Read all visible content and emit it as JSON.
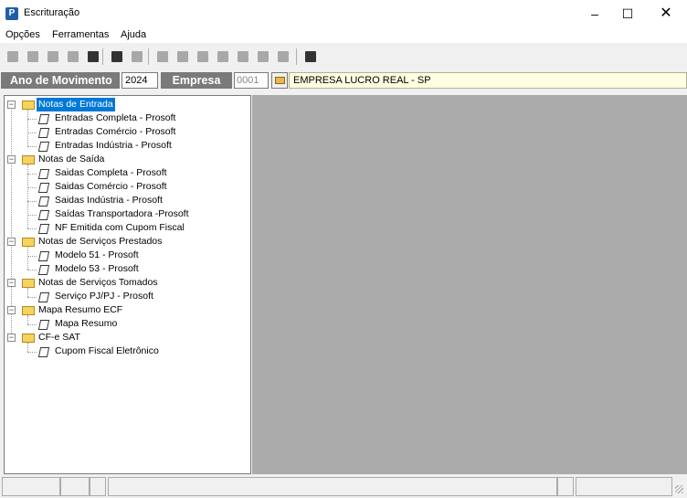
{
  "window": {
    "title": "Escrituração",
    "minimize": "–",
    "maximize": "☐",
    "close": "✕"
  },
  "menu": {
    "items": [
      "Opções",
      "Ferramentas",
      "Ajuda"
    ]
  },
  "toolbar": {
    "buttons": [
      "new-icon",
      "undo-icon",
      "stop-icon",
      "tools-icon",
      "preview-icon",
      "tree-view-icon",
      "entry-icon",
      "document-icon",
      "register-icon",
      "stamp-icon",
      "group-icon",
      "cib-icon",
      "list-icon",
      "book-icon",
      "exit-door-icon"
    ]
  },
  "selection": {
    "ano_label": "Ano de Movimento",
    "ano_value": "2024",
    "empresa_label": "Empresa",
    "empresa_code": "0001",
    "empresa_name": "EMPRESA LUCRO REAL - SP"
  },
  "tree": [
    {
      "label": "Notas de Entrada",
      "selected": true,
      "children": [
        "Entradas Completa - Prosoft",
        "Entradas Comércio - Prosoft",
        "Entradas Indústria - Prosoft"
      ]
    },
    {
      "label": "Notas de Saída",
      "children": [
        "Saidas Completa - Prosoft",
        "Saidas Comércio - Prosoft",
        "Saidas Indústria - Prosoft",
        "Saídas Transportadora -Prosoft",
        "NF Emitida com Cupom Fiscal"
      ]
    },
    {
      "label": "Notas de Serviços Prestados",
      "children": [
        "Modelo 51 - Prosoft",
        "Modelo 53 - Prosoft"
      ]
    },
    {
      "label": "Notas de Serviços Tomados",
      "children": [
        "Serviço PJ/PJ - Prosoft"
      ]
    },
    {
      "label": "Mapa Resumo ECF",
      "children": [
        "Mapa Resumo"
      ]
    },
    {
      "label": "CF-e SAT",
      "children": [
        "Cupom Fiscal Eletrônico"
      ]
    }
  ],
  "colors": {
    "accent": "#0078d7",
    "label_bg": "#7a7a7a",
    "content_bg": "#ababab",
    "name_bg": "#fffee0"
  }
}
